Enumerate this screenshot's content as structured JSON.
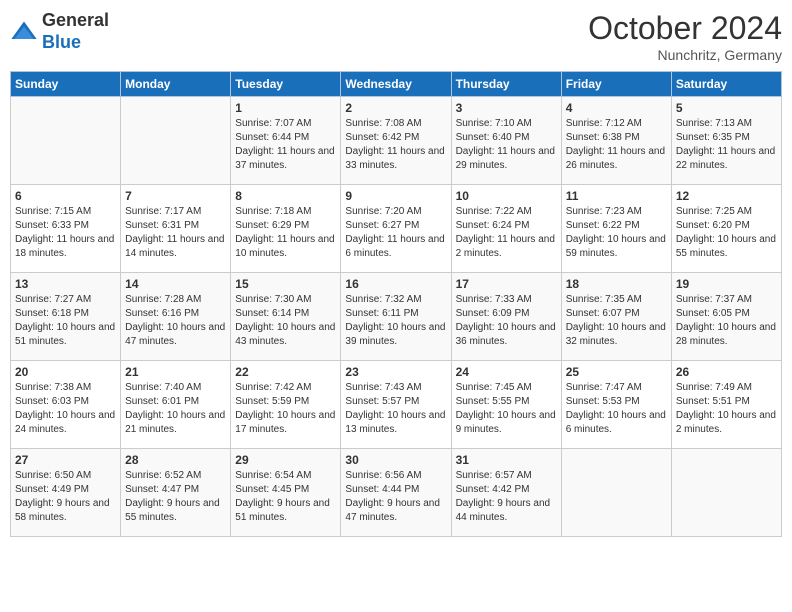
{
  "header": {
    "logo_general": "General",
    "logo_blue": "Blue",
    "month_title": "October 2024",
    "location": "Nunchritz, Germany"
  },
  "days_of_week": [
    "Sunday",
    "Monday",
    "Tuesday",
    "Wednesday",
    "Thursday",
    "Friday",
    "Saturday"
  ],
  "weeks": [
    [
      {
        "day": "",
        "info": ""
      },
      {
        "day": "",
        "info": ""
      },
      {
        "day": "1",
        "info": "Sunrise: 7:07 AM\nSunset: 6:44 PM\nDaylight: 11 hours and 37 minutes."
      },
      {
        "day": "2",
        "info": "Sunrise: 7:08 AM\nSunset: 6:42 PM\nDaylight: 11 hours and 33 minutes."
      },
      {
        "day": "3",
        "info": "Sunrise: 7:10 AM\nSunset: 6:40 PM\nDaylight: 11 hours and 29 minutes."
      },
      {
        "day": "4",
        "info": "Sunrise: 7:12 AM\nSunset: 6:38 PM\nDaylight: 11 hours and 26 minutes."
      },
      {
        "day": "5",
        "info": "Sunrise: 7:13 AM\nSunset: 6:35 PM\nDaylight: 11 hours and 22 minutes."
      }
    ],
    [
      {
        "day": "6",
        "info": "Sunrise: 7:15 AM\nSunset: 6:33 PM\nDaylight: 11 hours and 18 minutes."
      },
      {
        "day": "7",
        "info": "Sunrise: 7:17 AM\nSunset: 6:31 PM\nDaylight: 11 hours and 14 minutes."
      },
      {
        "day": "8",
        "info": "Sunrise: 7:18 AM\nSunset: 6:29 PM\nDaylight: 11 hours and 10 minutes."
      },
      {
        "day": "9",
        "info": "Sunrise: 7:20 AM\nSunset: 6:27 PM\nDaylight: 11 hours and 6 minutes."
      },
      {
        "day": "10",
        "info": "Sunrise: 7:22 AM\nSunset: 6:24 PM\nDaylight: 11 hours and 2 minutes."
      },
      {
        "day": "11",
        "info": "Sunrise: 7:23 AM\nSunset: 6:22 PM\nDaylight: 10 hours and 59 minutes."
      },
      {
        "day": "12",
        "info": "Sunrise: 7:25 AM\nSunset: 6:20 PM\nDaylight: 10 hours and 55 minutes."
      }
    ],
    [
      {
        "day": "13",
        "info": "Sunrise: 7:27 AM\nSunset: 6:18 PM\nDaylight: 10 hours and 51 minutes."
      },
      {
        "day": "14",
        "info": "Sunrise: 7:28 AM\nSunset: 6:16 PM\nDaylight: 10 hours and 47 minutes."
      },
      {
        "day": "15",
        "info": "Sunrise: 7:30 AM\nSunset: 6:14 PM\nDaylight: 10 hours and 43 minutes."
      },
      {
        "day": "16",
        "info": "Sunrise: 7:32 AM\nSunset: 6:11 PM\nDaylight: 10 hours and 39 minutes."
      },
      {
        "day": "17",
        "info": "Sunrise: 7:33 AM\nSunset: 6:09 PM\nDaylight: 10 hours and 36 minutes."
      },
      {
        "day": "18",
        "info": "Sunrise: 7:35 AM\nSunset: 6:07 PM\nDaylight: 10 hours and 32 minutes."
      },
      {
        "day": "19",
        "info": "Sunrise: 7:37 AM\nSunset: 6:05 PM\nDaylight: 10 hours and 28 minutes."
      }
    ],
    [
      {
        "day": "20",
        "info": "Sunrise: 7:38 AM\nSunset: 6:03 PM\nDaylight: 10 hours and 24 minutes."
      },
      {
        "day": "21",
        "info": "Sunrise: 7:40 AM\nSunset: 6:01 PM\nDaylight: 10 hours and 21 minutes."
      },
      {
        "day": "22",
        "info": "Sunrise: 7:42 AM\nSunset: 5:59 PM\nDaylight: 10 hours and 17 minutes."
      },
      {
        "day": "23",
        "info": "Sunrise: 7:43 AM\nSunset: 5:57 PM\nDaylight: 10 hours and 13 minutes."
      },
      {
        "day": "24",
        "info": "Sunrise: 7:45 AM\nSunset: 5:55 PM\nDaylight: 10 hours and 9 minutes."
      },
      {
        "day": "25",
        "info": "Sunrise: 7:47 AM\nSunset: 5:53 PM\nDaylight: 10 hours and 6 minutes."
      },
      {
        "day": "26",
        "info": "Sunrise: 7:49 AM\nSunset: 5:51 PM\nDaylight: 10 hours and 2 minutes."
      }
    ],
    [
      {
        "day": "27",
        "info": "Sunrise: 6:50 AM\nSunset: 4:49 PM\nDaylight: 9 hours and 58 minutes."
      },
      {
        "day": "28",
        "info": "Sunrise: 6:52 AM\nSunset: 4:47 PM\nDaylight: 9 hours and 55 minutes."
      },
      {
        "day": "29",
        "info": "Sunrise: 6:54 AM\nSunset: 4:45 PM\nDaylight: 9 hours and 51 minutes."
      },
      {
        "day": "30",
        "info": "Sunrise: 6:56 AM\nSunset: 4:44 PM\nDaylight: 9 hours and 47 minutes."
      },
      {
        "day": "31",
        "info": "Sunrise: 6:57 AM\nSunset: 4:42 PM\nDaylight: 9 hours and 44 minutes."
      },
      {
        "day": "",
        "info": ""
      },
      {
        "day": "",
        "info": ""
      }
    ]
  ]
}
